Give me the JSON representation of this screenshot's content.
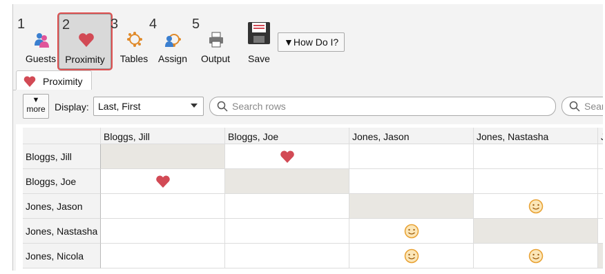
{
  "toolbar": {
    "buttons": [
      {
        "num": "1",
        "label": "Guests",
        "icon": "guests-icon"
      },
      {
        "num": "2",
        "label": "Proximity",
        "icon": "heart-icon",
        "active": true
      },
      {
        "num": "3",
        "label": "Tables",
        "icon": "table-icon"
      },
      {
        "num": "4",
        "label": "Assign",
        "icon": "assign-icon"
      },
      {
        "num": "5",
        "label": "Output",
        "icon": "printer-icon"
      },
      {
        "num": "",
        "label": "Save",
        "icon": "save-icon"
      }
    ],
    "how_do_i": "▼How Do I?"
  },
  "tab": {
    "label": "Proximity",
    "icon": "heart-icon"
  },
  "filter": {
    "more_label": "more",
    "more_arrow": "▼",
    "display_label": "Display:",
    "display_value": "Last, First",
    "search_rows_placeholder": "Search rows",
    "search_cols_placeholder": "Search columns"
  },
  "grid": {
    "columns": [
      "Bloggs, Jill",
      "Bloggs, Joe",
      "Jones, Jason",
      "Jones, Nastasha",
      "J"
    ],
    "rows": [
      {
        "name": "Bloggs, Jill",
        "cells": [
          "diag",
          "heart",
          "",
          "",
          ""
        ]
      },
      {
        "name": "Bloggs, Joe",
        "cells": [
          "heart",
          "diag",
          "",
          "",
          ""
        ]
      },
      {
        "name": "Jones, Jason",
        "cells": [
          "",
          "",
          "diag",
          "smiley",
          ""
        ]
      },
      {
        "name": "Jones, Nastasha",
        "cells": [
          "",
          "",
          "smiley",
          "diag",
          ""
        ]
      },
      {
        "name": "Jones, Nicola",
        "cells": [
          "",
          "",
          "smiley",
          "smiley",
          "diag"
        ]
      }
    ]
  },
  "colors": {
    "heart": "#d24a55",
    "smiley": "#e8a030",
    "active_outline": "#e05050",
    "diag": "#e9e7e2"
  }
}
